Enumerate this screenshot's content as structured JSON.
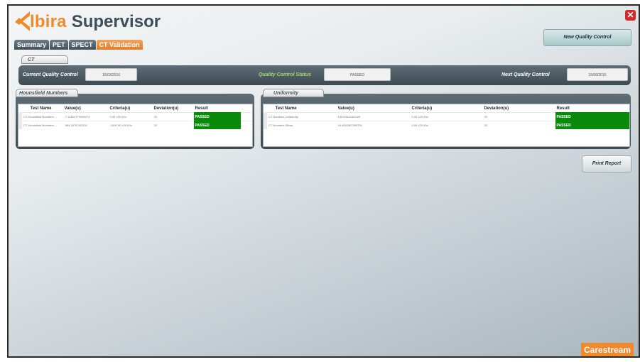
{
  "header": {
    "brand": "lbira",
    "app_name": "Supervisor",
    "close_symbol": "✕"
  },
  "tabs": [
    {
      "label": "Summary",
      "active": false
    },
    {
      "label": "PET",
      "active": false
    },
    {
      "label": "SPECT",
      "active": false
    },
    {
      "label": "CT Validation",
      "active": true
    }
  ],
  "toolbar": {
    "new_qc_label": "New Quality Control",
    "print_label": "Print Report"
  },
  "ct_group": {
    "title": "CT",
    "current_qc_label": "Current Quality Control",
    "current_qc_value": "15/03/2016",
    "status_label": "Quality Control Status",
    "status_value": "PASSED",
    "next_qc_label": "Next Quality Control",
    "next_qc_value": "15/06/2016"
  },
  "hounsfield": {
    "title": "Hounsfield Numbers",
    "columns": [
      "Test Name",
      "Value(u)",
      "Criteria(u)",
      "Deviation(u)",
      "Result"
    ],
    "rows": [
      [
        "CT Hounsfield Numbers ...",
        "-7.14524779050074",
        "0.00 ±20.00u",
        "20",
        "PASSED"
      ],
      [
        "CT Hounsfield Numbers ...",
        "-994.3478 002101",
        "-1000.00 ±20.00u",
        "20",
        "PASSED"
      ]
    ]
  },
  "uniformity": {
    "title": "Uniformity",
    "columns": [
      "Test Name",
      "Value(u)",
      "Criteria(u)",
      "Deviation(u)",
      "Result"
    ],
    "rows": [
      [
        "CT Numbers Uniformity",
        "8.8720611181005",
        "0.00 ±20.00u",
        "20",
        "PASSED"
      ],
      [
        "CT Numbers Slices",
        "16.4052067055751",
        "0.00 ±20.00u",
        "20",
        "PASSED"
      ]
    ]
  },
  "footer": {
    "company": "Carestream"
  },
  "colors": {
    "accent": "#f0892a",
    "pass": "#0a8a0a",
    "header_bar": "#4a5860",
    "status_text": "#a5d96e"
  }
}
